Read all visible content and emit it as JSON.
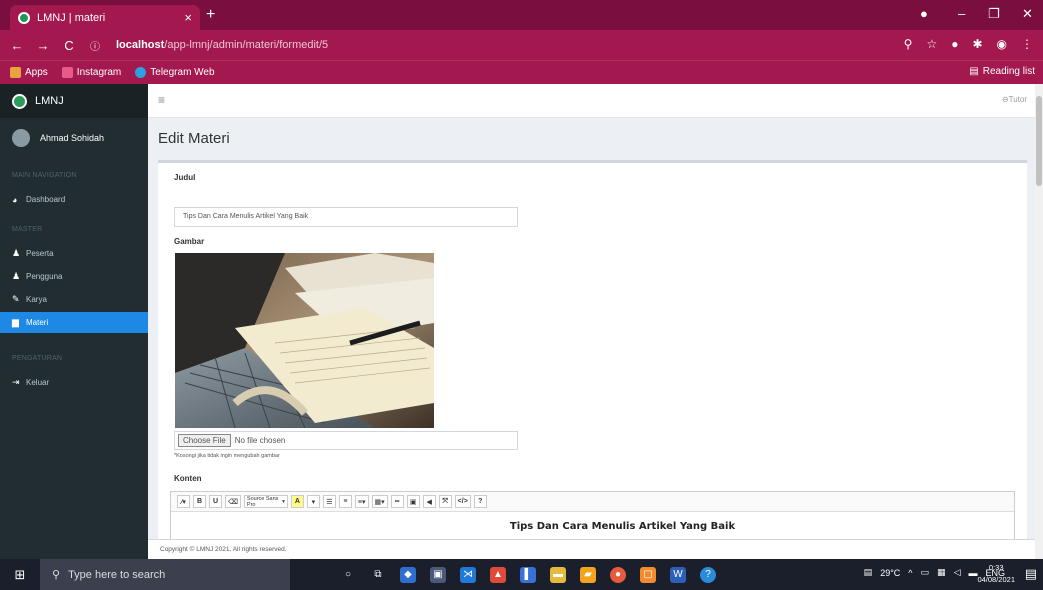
{
  "browser": {
    "tab_title": "LMNJ | materi",
    "tab_close": "×",
    "new_tab": "+",
    "url_host": "localhost",
    "url_path": "/app-lmnj/admin/materi/formedit/5",
    "bookmarks": [
      {
        "label": "Apps",
        "color": "#e8a33d"
      },
      {
        "label": "Instagram",
        "color": "#e85a8a"
      },
      {
        "label": "Telegram Web",
        "color": "#2f9fe0"
      }
    ],
    "reading_list": "Reading list"
  },
  "sidebar": {
    "brand": "LMNJ",
    "user_name": "Ahmad Sohidah",
    "sections": {
      "main": "MAIN NAVIGATION",
      "master": "MASTER",
      "settings": "PENGATURAN"
    },
    "items": {
      "dashboard": "Dashboard",
      "peserta": "Peserta",
      "pengguna": "Pengguna",
      "karya": "Karya",
      "materi": "Materi",
      "keluar": "Keluar"
    }
  },
  "header": {
    "menu_icon": "≡",
    "tutor": "Tutor"
  },
  "page": {
    "title": "Edit Materi",
    "judul_label": "Judul",
    "judul_value": "Tips Dan Cara Menulis Artikel Yang Baik",
    "gambar_label": "Gambar",
    "choose_file": "Choose File",
    "no_file": "No file chosen",
    "hint": "*Kosongi jika tidak ingin mengubah gambar",
    "konten_label": "Konten",
    "font_select": "Source Sans Pro",
    "editor_heading": "Tips Dan Cara Menulis Artikel Yang Baik"
  },
  "footer": {
    "text": "Copyright © LMNJ 2021. All rights reserved."
  },
  "taskbar": {
    "search_placeholder": "Type here to search",
    "temperature": "29°C",
    "lang": "ENG",
    "time": "0:33",
    "date": "04/08/2021"
  }
}
